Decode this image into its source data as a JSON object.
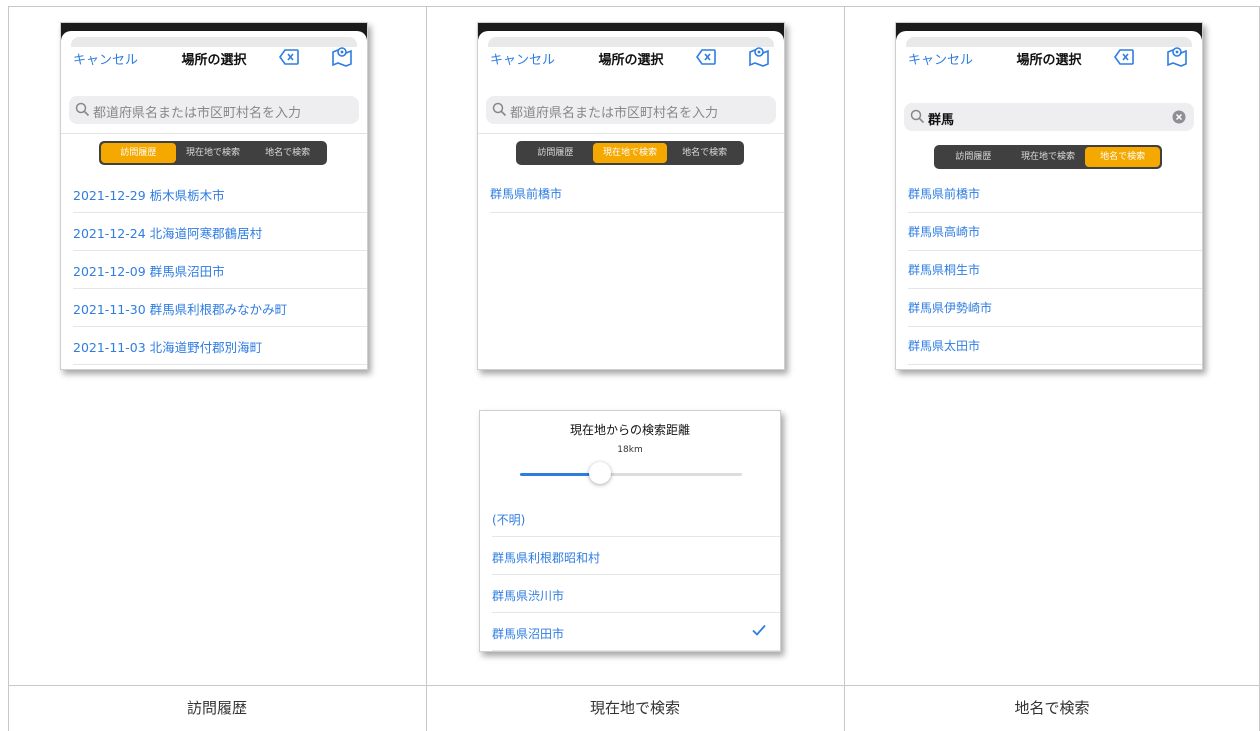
{
  "captions": [
    "訪問履歴",
    "現在地で検索",
    "地名で検索"
  ],
  "nav": {
    "cancel": "キャンセル",
    "title": "場所の選択"
  },
  "search": {
    "placeholder": "都道府県名または市区町村名を入力",
    "value": "群馬"
  },
  "segments": [
    "訪問履歴",
    "現在地で検索",
    "地名で検索"
  ],
  "panel1": {
    "active_segment": "訪問履歴",
    "items": [
      "2021-12-29 栃木県栃木市",
      "2021-12-24 北海道阿寒郡鶴居村",
      "2021-12-09 群馬県沼田市",
      "2021-11-30 群馬県利根郡みなかみ町",
      "2021-11-03 北海道野付郡別海町"
    ]
  },
  "panel2": {
    "active_segment": "現在地で検索",
    "items": [
      "群馬県前橋市"
    ]
  },
  "panel3": {
    "active_segment": "地名で検索",
    "items": [
      "群馬県前橋市",
      "群馬県高崎市",
      "群馬県桐生市",
      "群馬県伊勢崎市",
      "群馬県太田市"
    ]
  },
  "distance_panel": {
    "title": "現在地からの検索距離",
    "distance_label": "18km",
    "slider_fraction": 0.36,
    "items": [
      "(不明)",
      "群馬県利根郡昭和村",
      "群馬県渋川市",
      "群馬県沼田市"
    ],
    "selected_index": 3
  },
  "colors": {
    "accent": "#2f7de1",
    "segment_active": "#f5a800",
    "segment_bg": "#404040"
  }
}
